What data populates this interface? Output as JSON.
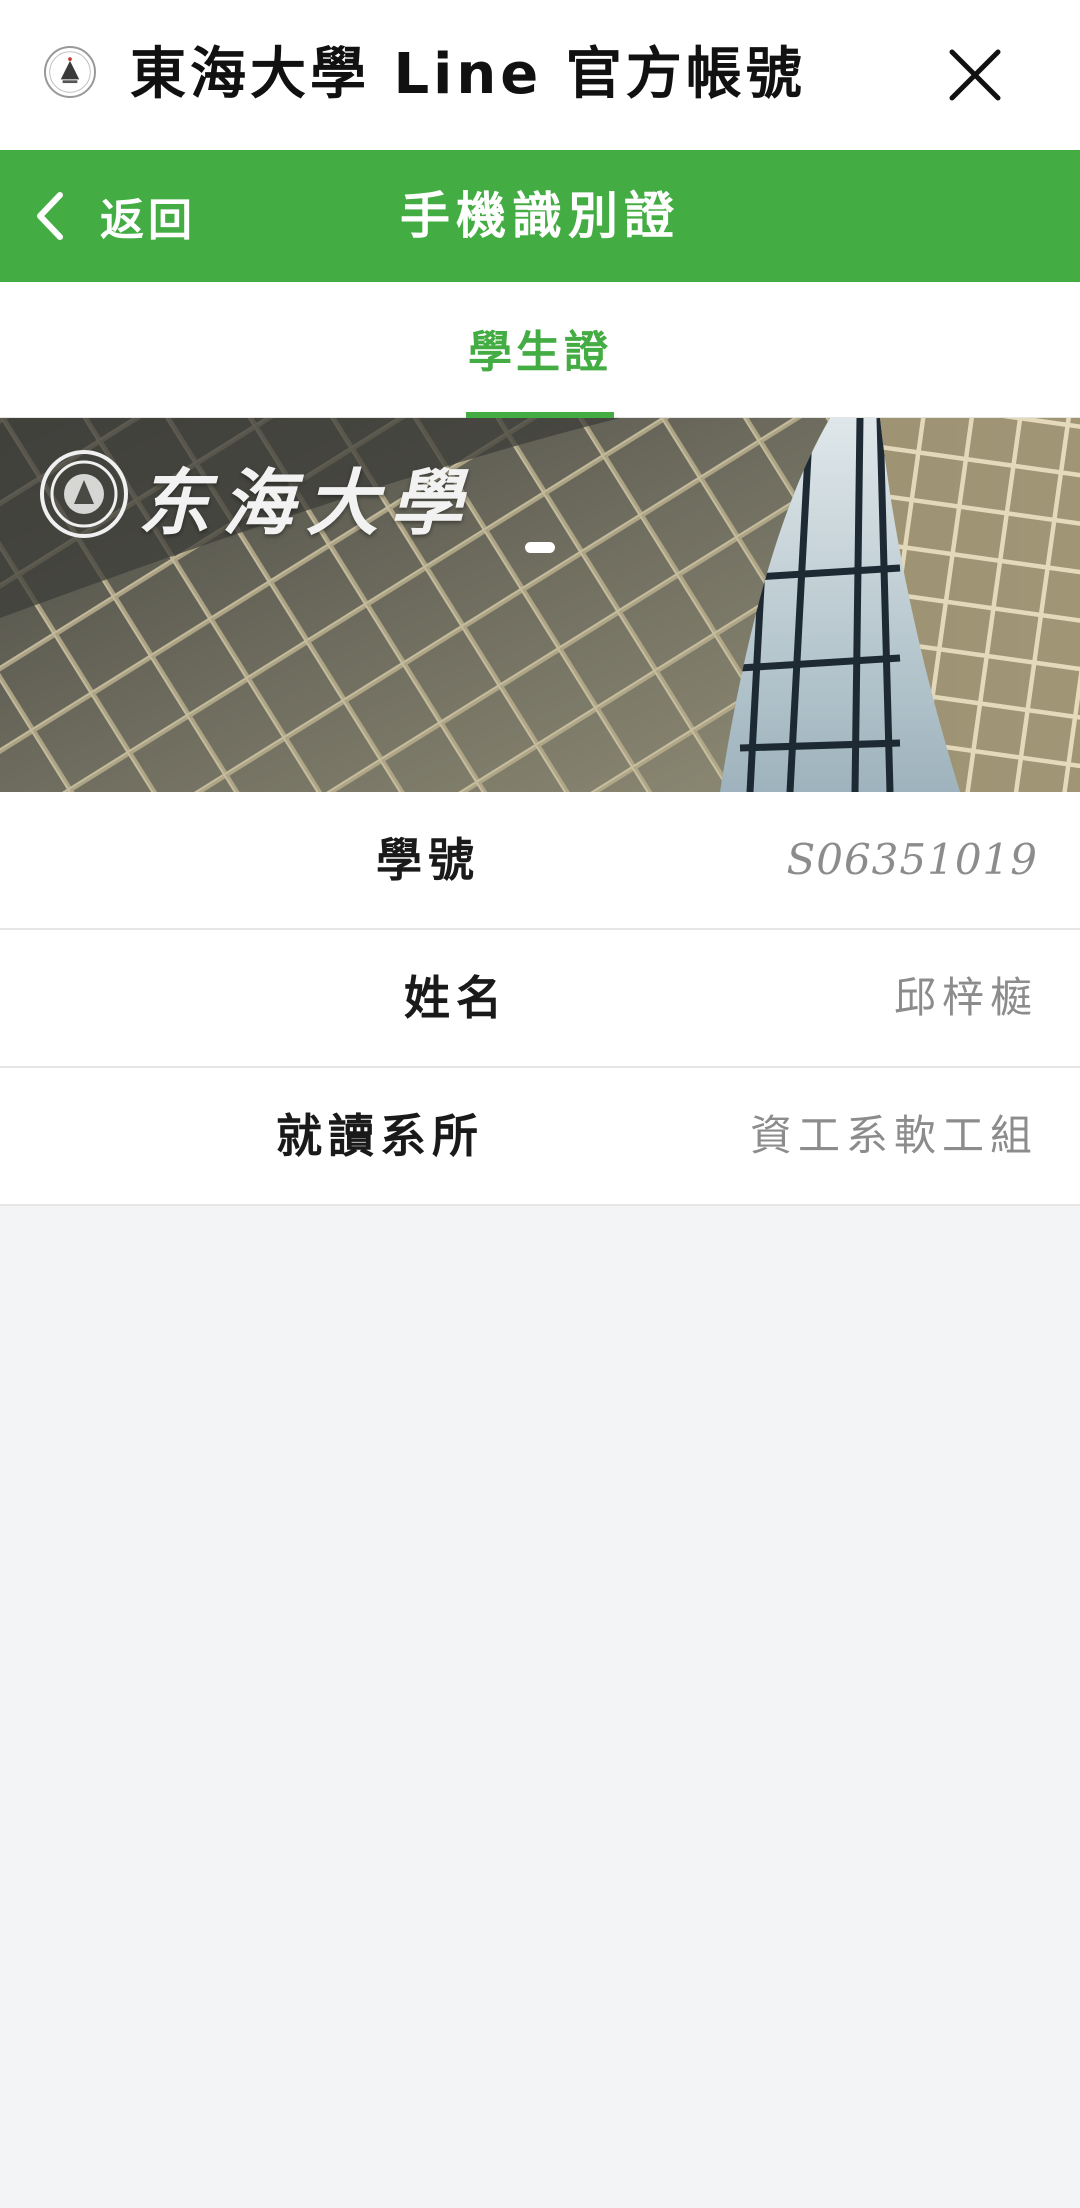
{
  "app_bar": {
    "title": "東海大學 Line 官方帳號",
    "logo_icon": "university-seal-icon",
    "close_icon": "close-icon"
  },
  "header": {
    "back_label": "返回",
    "back_icon": "chevron-left-icon",
    "title": "手機識別證",
    "color": "#43ac43"
  },
  "tabs": [
    {
      "label": "學生證",
      "active": true
    }
  ],
  "banner": {
    "brand_text": "东海大學",
    "carousel": {
      "count": 1,
      "active": 0
    }
  },
  "student_info": [
    {
      "label": "學號",
      "value": "S06351019"
    },
    {
      "label": "姓名",
      "value": "邱梓榳"
    },
    {
      "label": "就讀系所",
      "value": "資工系軟工組"
    }
  ],
  "colors": {
    "accent": "#43ac43",
    "background": "#f3f4f6",
    "label": "#1a1a1a",
    "value": "#8c8c8c"
  }
}
